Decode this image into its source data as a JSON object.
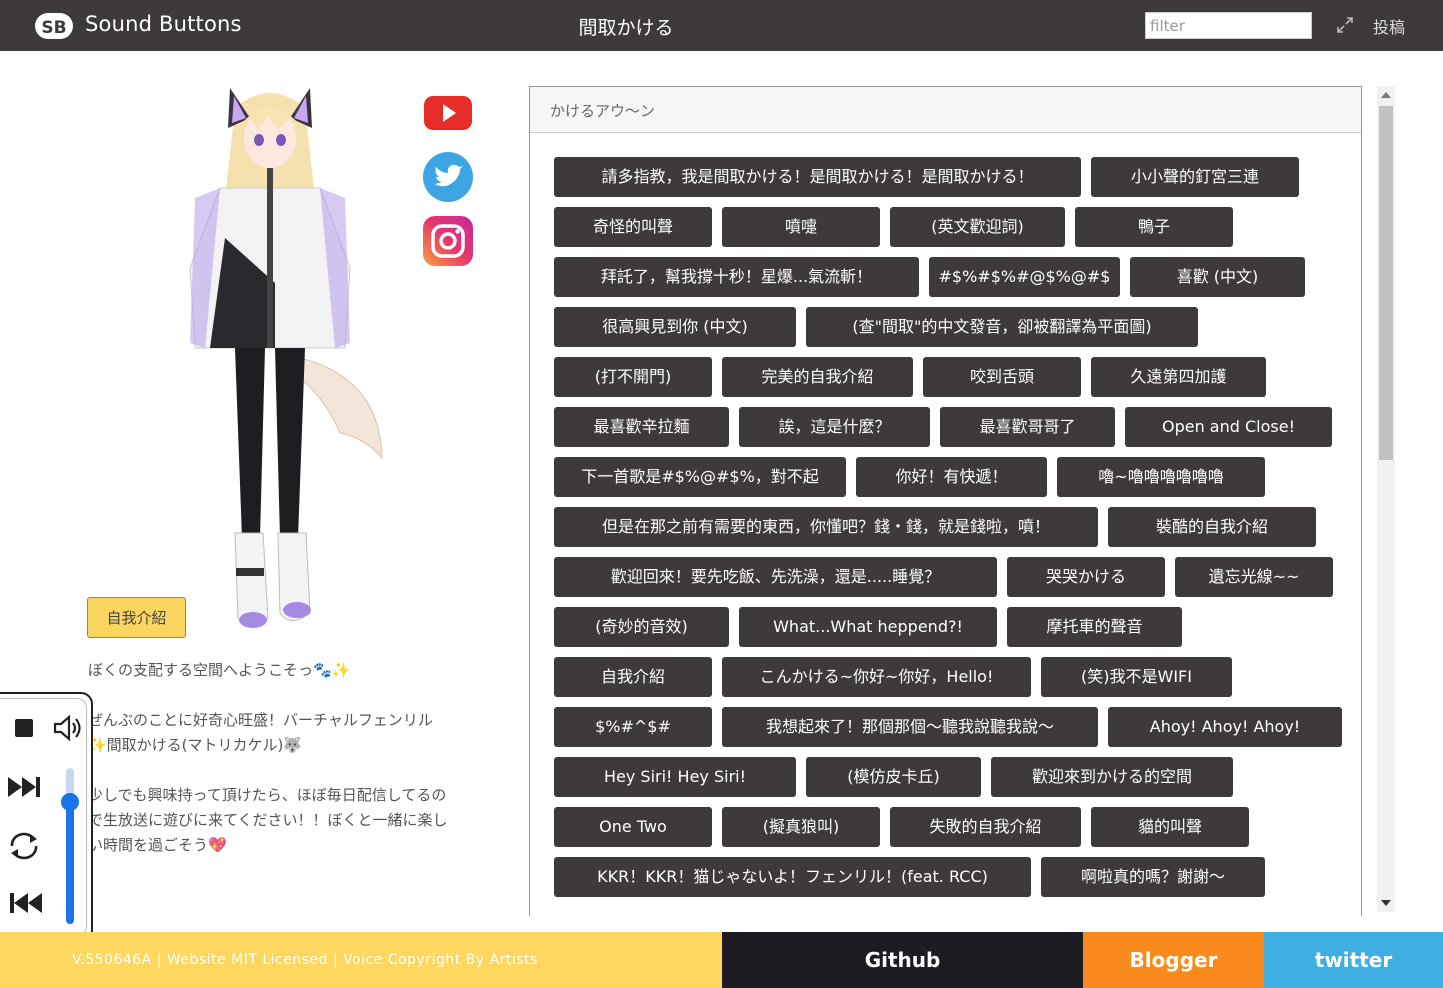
{
  "header": {
    "brand": "Sound Buttons",
    "title": "間取かける",
    "filter_placeholder": "filter",
    "post_label": "投稿"
  },
  "left": {
    "intro_button": "自我介紹",
    "description": [
      "ぼくの支配する空間へようこそっ🐾✨",
      "ぜんぶのことに好奇心旺盛！バーチャルフェンリル✨間取かける(マトリカケル)🐺",
      "少しでも興味持って頂けたら、ほぼ毎日配信してるので生放送に遊びに来てください！！ぼくと一緒に楽しい時間を過ごそう💖"
    ],
    "social": [
      "youtube-icon",
      "twitter-icon",
      "instagram-icon"
    ]
  },
  "panel": {
    "heading": "かけるアウ～ン",
    "rows": [
      [
        "請多指教，我是間取かける！是間取かける！是間取かける！",
        "小小聲的釘宮三連"
      ],
      [
        "奇怪的叫聲",
        "噴嚏",
        "(英文歡迎詞)",
        "鴨子"
      ],
      [
        "拜託了，幫我撐十秒！星爆...氣流斬！",
        "#$%#$%#@$%@#$",
        "喜歡 (中文)"
      ],
      [
        "很高興見到你 (中文)",
        "(查\"間取\"的中文發音，卻被翻譯為平面圖)"
      ],
      [
        "(打不開門)",
        "完美的自我介紹",
        "咬到舌頭",
        "久遠第四加護"
      ],
      [
        "最喜歡辛拉麵",
        "誒，這是什麼？",
        "最喜歡哥哥了",
        "Open and Close!"
      ],
      [
        "下一首歌是#$%@#$%，對不起",
        "你好！有快遞！",
        "嚕~嚕嚕嚕嚕嚕嚕"
      ],
      [
        "但是在那之前有需要的東西，你懂吧？錢・錢，就是錢啦，噴！",
        "裝酷的自我介紹"
      ],
      [
        "歡迎回來！要先吃飯、先洗澡，還是.....睡覺？",
        "哭哭かける",
        "遺忘光線~~"
      ],
      [
        "(奇妙的音效)",
        "What...What heppend?!",
        "摩托車的聲音"
      ],
      [
        "自我介紹",
        "こんかける~你好~你好，Hello!",
        "(笑)我不是WIFI"
      ],
      [
        "$%#^$#",
        "我想起來了！那個那個～聽我說聽我說～",
        "Ahoy! Ahoy! Ahoy!"
      ],
      [
        "Hey Siri! Hey Siri!",
        "(模仿皮卡丘)",
        "歡迎來到かける的空間"
      ],
      [
        "One Two",
        "(擬真狼叫)",
        "失敗的自我介紹",
        "貓的叫聲"
      ],
      [
        "KKR！KKR！猫じゃないよ！フェンリル！(feat. RCC)",
        "啊啦真的嗎？謝謝～"
      ]
    ]
  },
  "footer": {
    "info": "V.550646A | Website MIT Licensed | Voice Copyright By Artists",
    "github": "Github",
    "blogger": "Blogger",
    "twitter": "twitter"
  },
  "colors": {
    "header_bg": "#3e3a39",
    "button_bg": "#3e3a39",
    "accent_yellow": "#fdd75f",
    "github_bg": "#1e1b22",
    "blogger_bg": "#fb8a1d",
    "twitter_bg": "#3faee0"
  }
}
